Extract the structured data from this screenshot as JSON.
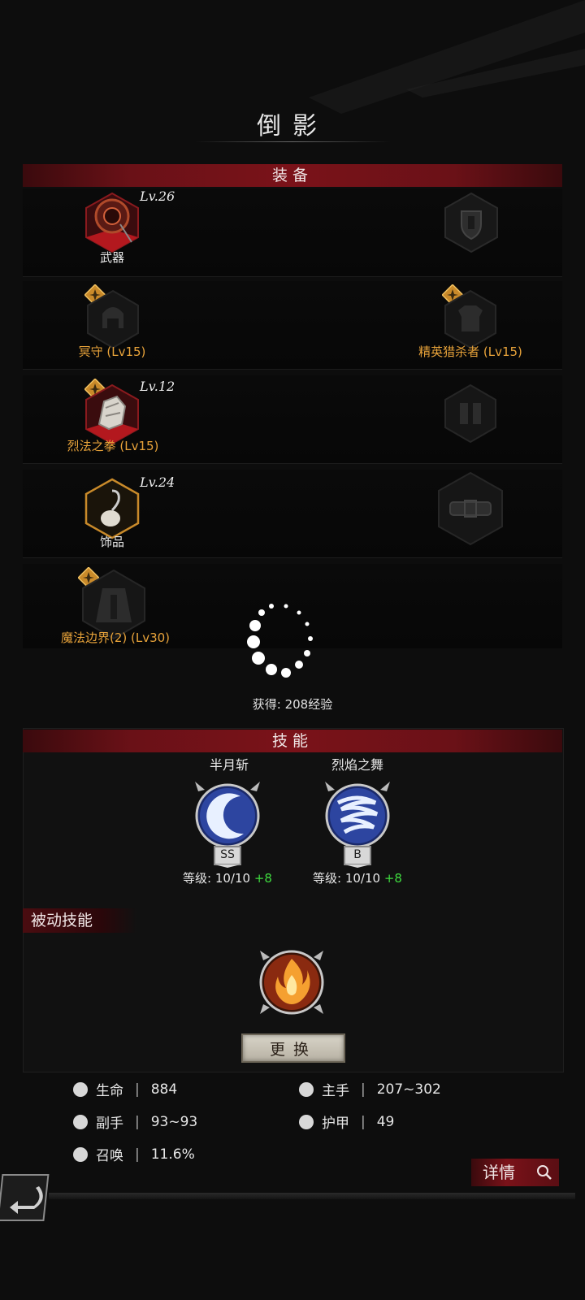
{
  "title": "倒影",
  "sections": {
    "equipment": "装备",
    "skills": "技能",
    "passive": "被动技能"
  },
  "equipment_rows": [
    {
      "left": {
        "label": "武器",
        "level": "Lv.26",
        "label_style": "white",
        "has_badge": false,
        "item": "weapon"
      },
      "right": {
        "icon": "shield-slot-icon",
        "label": ""
      }
    },
    {
      "left": {
        "label": "冥守 (Lv15)",
        "level": "",
        "label_style": "gold",
        "has_badge": true,
        "item": "helmet-empty"
      },
      "right": {
        "icon": "armor-slot-icon",
        "label": "精英猎杀者 (Lv15)",
        "label_style": "gold",
        "has_badge": true
      }
    },
    {
      "left": {
        "label": "烈法之拳 (Lv15)",
        "level": "Lv.12",
        "label_style": "gold",
        "has_badge": true,
        "item": "gauntlet"
      },
      "right": {
        "icon": "boots-slot-icon",
        "label": ""
      }
    },
    {
      "left": {
        "label": "饰品",
        "level": "Lv.24",
        "label_style": "white",
        "has_badge": false,
        "item": "trinket"
      },
      "right": {
        "icon": "belt-slot-icon",
        "label": ""
      }
    },
    {
      "left": {
        "label": "魔法边界(2) (Lv30)",
        "level": "",
        "label_style": "gold",
        "has_badge": true,
        "item": "cape-empty"
      }
    }
  ],
  "exp_gain": "获得: 208经验",
  "skills": [
    {
      "name": "半月斩",
      "grade": "SS",
      "level_prefix": "等级: 10/10 ",
      "level_bonus": "+8"
    },
    {
      "name": "烈焰之舞",
      "grade": "B",
      "level_prefix": "等级: 10/10 ",
      "level_bonus": "+8"
    }
  ],
  "swap_button": "更换",
  "stats": [
    {
      "icon": "heart-icon",
      "label": "生命",
      "value": "884"
    },
    {
      "icon": "sword-icon",
      "label": "主手",
      "value": "207~302"
    },
    {
      "icon": "dagger-icon",
      "label": "副手",
      "value": "93~93"
    },
    {
      "icon": "armor-icon",
      "label": "护甲",
      "value": "49"
    },
    {
      "icon": "summon-icon",
      "label": "召唤",
      "value": "11.6%"
    }
  ],
  "details_button": "详情",
  "colors": {
    "accent_red": "#7a1219",
    "gold": "#e8a33a",
    "bonus_green": "#3fdc3f"
  }
}
